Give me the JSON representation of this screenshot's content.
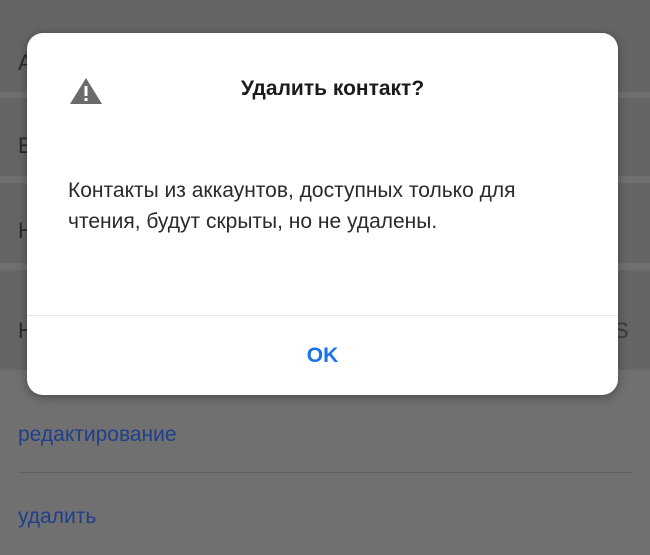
{
  "background": {
    "rows": [
      {
        "text": "А"
      },
      {
        "text": "Е"
      },
      {
        "text": "Н"
      },
      {
        "text": "Н"
      }
    ],
    "right_glyph": "S",
    "links": {
      "edit": "редактирование",
      "delete": "удалить"
    }
  },
  "dialog": {
    "icon": "warning-triangle-icon",
    "title": "Удалить контакт?",
    "message": "Контакты из аккаунтов, доступных только для чтения, будут скрыты, но не удалены.",
    "ok_label": "OK"
  },
  "colors": {
    "accent": "#1a73e8",
    "link": "#1f3f8c",
    "scrim": "#707070"
  }
}
